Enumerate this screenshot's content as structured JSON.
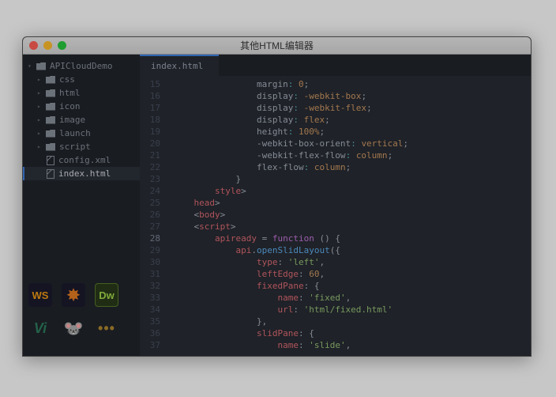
{
  "window": {
    "title": "其他HTML编辑器"
  },
  "tree": {
    "root": "APICloudDemo",
    "folders": [
      "css",
      "html",
      "icon",
      "image",
      "launch",
      "script"
    ],
    "files": [
      "config.xml",
      "index.html"
    ],
    "selected": "index.html"
  },
  "tab": {
    "label": "index.html"
  },
  "gutter": {
    "start": 15,
    "end": 37,
    "highlight": 28
  },
  "code": {
    "l15": {
      "prop": "margin",
      "val": "0"
    },
    "l16": {
      "prop": "display",
      "val": "-webkit-box"
    },
    "l17": {
      "prop": "display",
      "val": "-webkit-flex"
    },
    "l18": {
      "prop": "display",
      "val": "flex"
    },
    "l19": {
      "prop": "height",
      "val": "100%"
    },
    "l20": {
      "prop": "-webkit-box-orient",
      "val": "vertical"
    },
    "l21": {
      "prop": "-webkit-flex-flow",
      "val": "column"
    },
    "l22": {
      "prop": "flex-flow",
      "val": "column"
    },
    "l23": "}",
    "l24_open": "</",
    "l24_tag": "style",
    "l24_close": ">",
    "l25_open": "</",
    "l25_tag": "head",
    "l25_close": ">",
    "l26_open": "<",
    "l26_tag": "body",
    "l26_close": ">",
    "l27_open": "<",
    "l27_tag": "script",
    "l27_close": ">",
    "l28": {
      "var": "apiready",
      "op": " = ",
      "kw": "function",
      "rest": " () {"
    },
    "l29": {
      "obj": "api",
      "dot": ".",
      "fn": "openSlidLayout",
      "rest": "({"
    },
    "l30": {
      "key": "type",
      "val": "'left'",
      "comma": ","
    },
    "l31": {
      "key": "leftEdge",
      "num": "60",
      "comma": ","
    },
    "l32": {
      "key": "fixedPane",
      "rest": ": {"
    },
    "l33": {
      "key": "name",
      "val": "'fixed'",
      "comma": ","
    },
    "l34": {
      "key": "url",
      "val": "'html/fixed.html'"
    },
    "l35": "},",
    "l36": {
      "key": "slidPane",
      "rest": ": {"
    },
    "l37": {
      "key": "name",
      "val": "'slide'",
      "comma": ","
    }
  },
  "apps": {
    "ws": "WS",
    "dw": "Dw",
    "vi": "Vi",
    "dots": "•••"
  }
}
